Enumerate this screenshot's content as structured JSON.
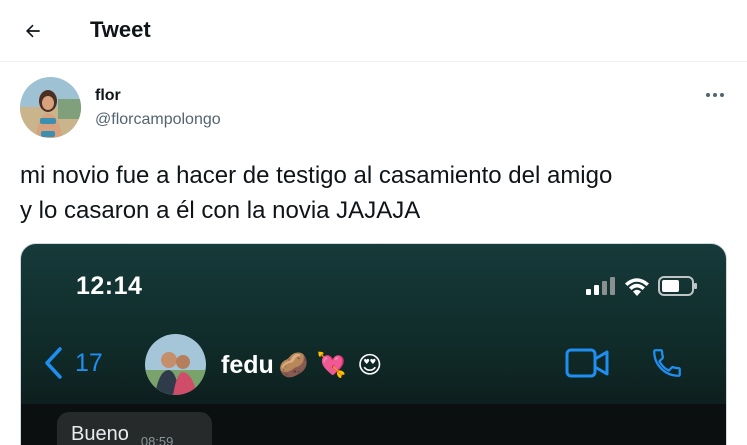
{
  "header": {
    "title": "Tweet",
    "back_icon": "arrow-left-icon"
  },
  "author": {
    "name": "flor",
    "handle": "@florcampolongo"
  },
  "more_icon": "more-horizontal-icon",
  "tweet": {
    "text": "mi novio fue a hacer de testigo al casamiento del amigo\ny lo casaron a él con la novia JAJAJA"
  },
  "media": {
    "status_bar": {
      "time": "12:14"
    },
    "chat": {
      "back_count": "17",
      "contact_name": "fedu",
      "contact_emojis": [
        "🥔",
        "💘",
        "😍"
      ],
      "video_icon": "video-call-icon",
      "call_icon": "phone-icon"
    },
    "message": {
      "text": "Bueno",
      "time": "08:59"
    }
  },
  "colors": {
    "accent": "#1f8ef1",
    "text": "#0f1419",
    "secondary": "#536471"
  }
}
